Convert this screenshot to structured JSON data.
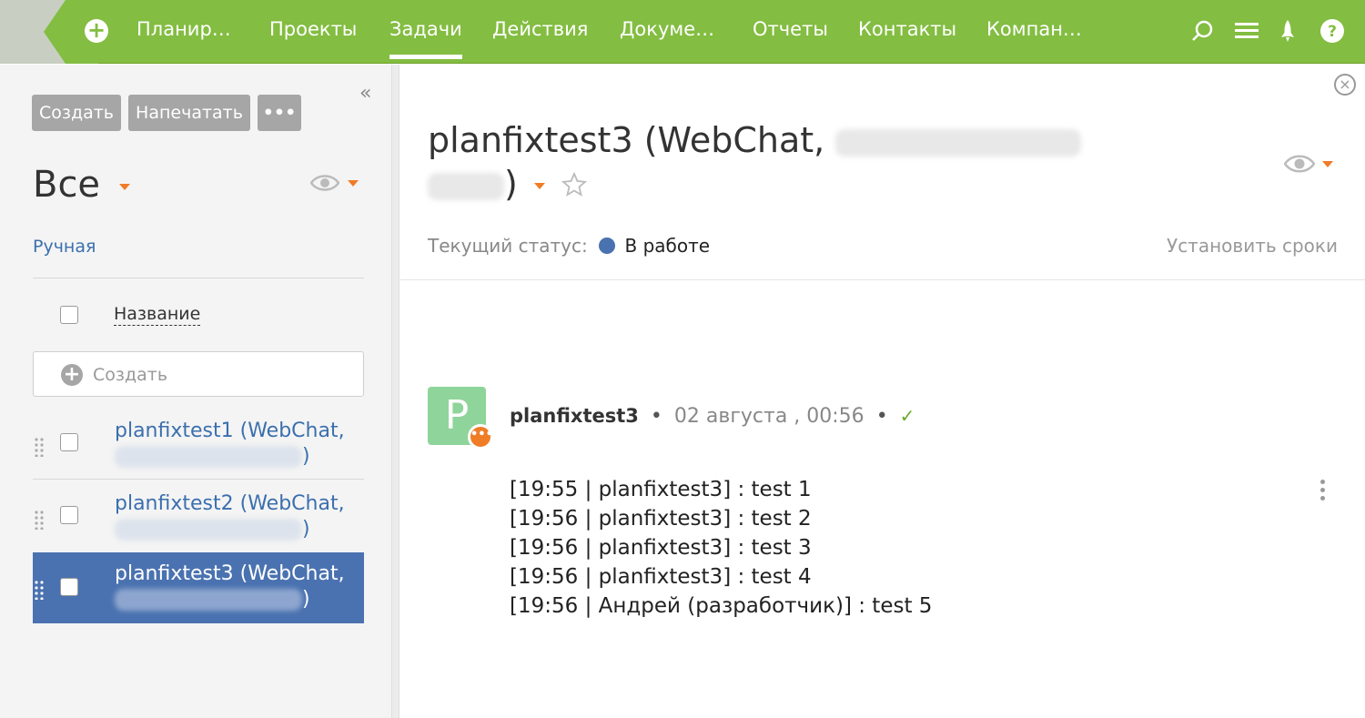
{
  "nav": {
    "items": [
      "Планир…",
      "Проекты",
      "Задачи",
      "Действия",
      "Докуме…",
      "Отчеты",
      "Контакты",
      "Компан…"
    ],
    "active": "Задачи"
  },
  "left": {
    "buttons": {
      "create": "Создать",
      "print": "Напечатать",
      "more": "•••"
    },
    "collapse": "«",
    "view_title": "Все",
    "sort_label": "Ручная",
    "column_header": "Название",
    "create_placeholder": "Создать",
    "tasks": [
      {
        "title": "planfixtest1 (WebChat,",
        "tail": ")"
      },
      {
        "title": "planfixtest2 (WebChat,",
        "tail": ")"
      },
      {
        "title": "planfixtest3 (WebChat,",
        "tail": ")"
      }
    ]
  },
  "task": {
    "title_prefix": "planfixtest3 (WebChat,",
    "title_suffix": ")",
    "status_label": "Текущий статус:",
    "status_value": "В работе",
    "set_deadline": "Установить сроки",
    "close": "×"
  },
  "message": {
    "avatar_letter": "P",
    "badge": "•••",
    "author": "planfixtest3",
    "date": "02 августа , 00:56",
    "lines": [
      "[19:55 | planfixtest3] : test 1",
      "[19:56 | planfixtest3] : test 2",
      "[19:56 | planfixtest3] : test 3",
      "[19:56 | planfixtest3] : test 4",
      "[19:56 | Андрей (разработчик)] : test 5"
    ]
  },
  "colors": {
    "brand_green": "#83bd41",
    "accent_orange": "#f07c26",
    "selection_blue": "#4a72b0"
  },
  "icons": [
    "add-icon",
    "search-icon",
    "menu-icon",
    "rocket-icon",
    "help-icon",
    "eye-icon",
    "star-icon",
    "close-icon",
    "check-icon",
    "drag-handle-icon",
    "kebab-icon"
  ]
}
